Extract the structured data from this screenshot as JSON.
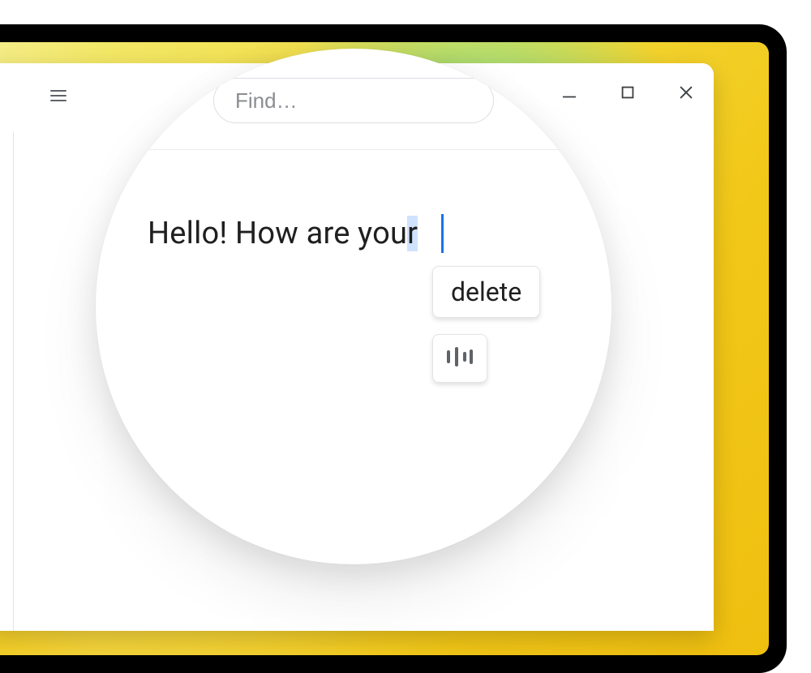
{
  "search": {
    "placeholder": "Find…"
  },
  "editor": {
    "text_before_selection": "Hello! How are you",
    "selected_text": "r"
  },
  "chips": {
    "delete_label": "delete"
  }
}
